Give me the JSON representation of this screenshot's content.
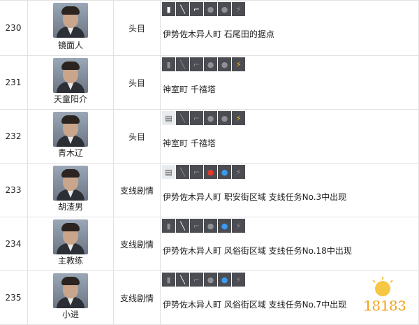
{
  "rows": [
    {
      "id": "230",
      "name": "镜面人",
      "type": "头目",
      "location": "伊势佐木异人町 石尾田的据点",
      "icons": [
        {
          "name": "stamp-icon",
          "state": "active"
        },
        {
          "name": "knife-icon",
          "state": "active"
        },
        {
          "name": "gun-icon",
          "state": "active"
        },
        {
          "name": "fire-icon",
          "state": "off"
        },
        {
          "name": "water-icon",
          "state": "off"
        },
        {
          "name": "lightning-icon",
          "state": "off"
        }
      ]
    },
    {
      "id": "231",
      "name": "天童阳介",
      "type": "头目",
      "location": "神室町 千禧塔",
      "icons": [
        {
          "name": "stamp-icon",
          "state": "off"
        },
        {
          "name": "knife-icon",
          "state": "off"
        },
        {
          "name": "gun-icon",
          "state": "off"
        },
        {
          "name": "fire-icon",
          "state": "off"
        },
        {
          "name": "water-icon",
          "state": "off"
        },
        {
          "name": "lightning-icon",
          "state": "active"
        }
      ]
    },
    {
      "id": "232",
      "name": "青木辽",
      "type": "头目",
      "location": "神室町 千禧塔",
      "icons": [
        {
          "name": "card-icon",
          "state": "active"
        },
        {
          "name": "knife-icon",
          "state": "off"
        },
        {
          "name": "gun-icon",
          "state": "off"
        },
        {
          "name": "fire-icon",
          "state": "off"
        },
        {
          "name": "water-icon",
          "state": "off"
        },
        {
          "name": "lightning-icon",
          "state": "active"
        }
      ]
    },
    {
      "id": "233",
      "name": "胡渣男",
      "type": "支线剧情",
      "location": "伊势佐木异人町 职安街区域 支线任务No.3中出现",
      "icons": [
        {
          "name": "card-icon",
          "state": "active"
        },
        {
          "name": "knife-icon",
          "state": "off"
        },
        {
          "name": "gun-icon",
          "state": "off"
        },
        {
          "name": "fire-icon",
          "state": "active"
        },
        {
          "name": "water-icon",
          "state": "active"
        },
        {
          "name": "lightning-icon",
          "state": "off"
        }
      ]
    },
    {
      "id": "234",
      "name": "主教练",
      "type": "支线剧情",
      "location": "伊势佐木异人町 风俗街区域 支线任务No.18中出现",
      "icons": [
        {
          "name": "stamp-icon",
          "state": "off"
        },
        {
          "name": "knife-icon",
          "state": "active"
        },
        {
          "name": "gun-icon",
          "state": "off"
        },
        {
          "name": "fire-icon",
          "state": "off"
        },
        {
          "name": "water-icon",
          "state": "active"
        },
        {
          "name": "lightning-icon",
          "state": "off"
        }
      ]
    },
    {
      "id": "235",
      "name": "小进",
      "type": "支线剧情",
      "location": "伊势佐木异人町 风俗街区域 支线任务No.7中出现",
      "icons": [
        {
          "name": "stamp-icon",
          "state": "off"
        },
        {
          "name": "knife-icon",
          "state": "active"
        },
        {
          "name": "gun-icon",
          "state": "off"
        },
        {
          "name": "fire-icon",
          "state": "off"
        },
        {
          "name": "water-icon",
          "state": "active"
        },
        {
          "name": "lightning-icon",
          "state": "off"
        }
      ]
    }
  ],
  "watermark": {
    "text": "18183"
  },
  "colors": {
    "icon_bg": "#4b4d52",
    "fire": "#e23a2b",
    "water": "#3b9bf0",
    "lightning": "#f5c11a",
    "border": "#e2e2e2"
  }
}
